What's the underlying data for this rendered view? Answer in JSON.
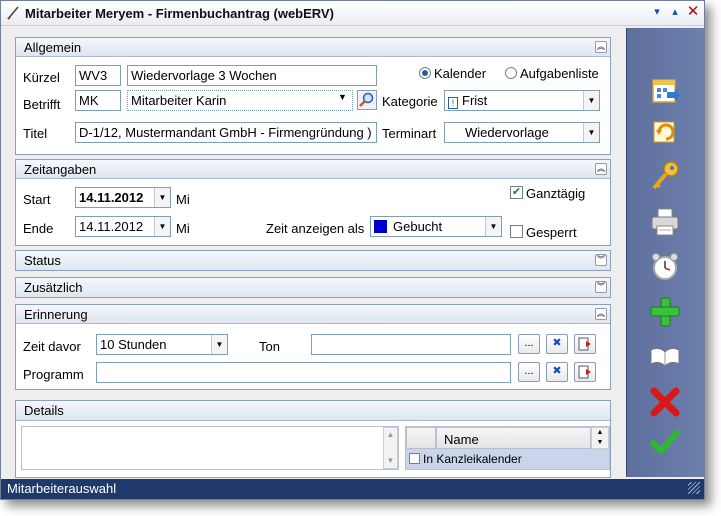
{
  "window": {
    "title": "Mitarbeiter Meryem - Firmenbuchantrag (webERV)",
    "controls": {
      "minimize": "▾",
      "maximize": "▴",
      "close": "✕"
    }
  },
  "allgemein": {
    "title": "Allgemein",
    "kuerzel_label": "Kürzel",
    "kuerzel_value": "WV3",
    "kuerzel_desc": "Wiedervorlage 3 Wochen",
    "betrifft_label": "Betrifft",
    "betrifft_code": "MK",
    "betrifft_name": "Mitarbeiter Karin",
    "titel_label": "Titel",
    "titel_value": "D-1/12, Mustermandant GmbH - Firmengründung )",
    "radio_kalender": "Kalender",
    "radio_aufgabenliste": "Aufgabenliste",
    "kategorie_label": "Kategorie",
    "kategorie_value": "Frist",
    "terminart_label": "Terminart",
    "terminart_value": "Wiedervorlage"
  },
  "zeitangaben": {
    "title": "Zeitangaben",
    "start_label": "Start",
    "start_date": "14.11.2012",
    "start_day": "Mi",
    "ende_label": "Ende",
    "ende_date": "14.11.2012",
    "ende_day": "Mi",
    "ganztaegig_label": "Ganztägig",
    "ganztaegig_checked": true,
    "zeit_anzeigen_label": "Zeit anzeigen als",
    "zeit_anzeigen_value": "Gebucht",
    "zeit_anzeigen_color": "#0000cc",
    "gesperrt_label": "Gesperrt",
    "gesperrt_checked": false
  },
  "status": {
    "title": "Status"
  },
  "zusaetzlich": {
    "title": "Zusätzlich"
  },
  "erinnerung": {
    "title": "Erinnerung",
    "zeit_davor_label": "Zeit davor",
    "zeit_davor_value": "10 Stunden",
    "ton_label": "Ton",
    "ton_value": "",
    "programm_label": "Programm",
    "programm_value": "",
    "browse_label": "..."
  },
  "details": {
    "title": "Details",
    "grid_column_name": "Name",
    "grid_row_label": "In Kanzleikalender"
  },
  "statusbar": {
    "text": "Mitarbeiterauswahl"
  },
  "toolbar": {
    "icons": [
      "calendar-arrow-icon",
      "refresh-icon",
      "key-icon",
      "printer-icon",
      "alarm-clock-icon",
      "add-plus-icon",
      "open-book-icon",
      "cancel-x-icon",
      "ok-check-icon"
    ]
  },
  "colors": {
    "toolbar": "#6374a3",
    "statusbar": "#1f3a6a",
    "section_border": "#8aa0bd"
  }
}
